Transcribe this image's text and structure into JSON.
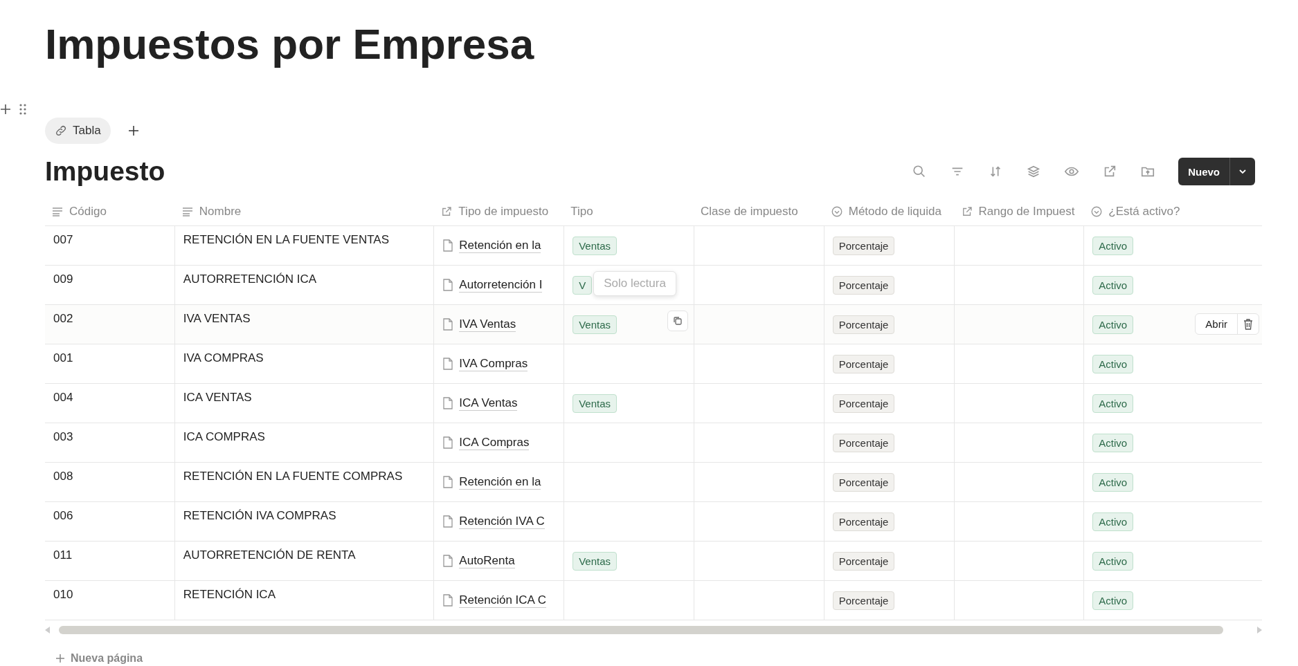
{
  "page_title": "Impuestos por Empresa",
  "views": [
    {
      "label": "Tabla",
      "selected": true
    }
  ],
  "database_title": "Impuesto",
  "new_button": {
    "label": "Nuevo"
  },
  "columns": [
    {
      "label": "Código",
      "kind": "text"
    },
    {
      "label": "Nombre",
      "kind": "text"
    },
    {
      "label": "Tipo de impuesto",
      "kind": "relation"
    },
    {
      "label": "Tipo",
      "kind": "plain"
    },
    {
      "label": "Clase de impuesto",
      "kind": "plain"
    },
    {
      "label": "Método de liquida",
      "kind": "status"
    },
    {
      "label": "Rango de Impuest",
      "kind": "relation"
    },
    {
      "label": "¿Está activo?",
      "kind": "status"
    }
  ],
  "row_actions": {
    "open": "Abrir"
  },
  "rows": [
    {
      "codigo": "007",
      "nombre": "RETENCIÓN EN LA FUENTE VENTAS",
      "tipo_impuesto": "Retención en la",
      "tipo": "Ventas",
      "metodo": "Porcentaje",
      "activo": "Activo",
      "hovered": false
    },
    {
      "codigo": "009",
      "nombre": "AUTORRETENCIÓN ICA",
      "tipo_impuesto": "Autorretención I",
      "tipo": "V",
      "tooltip": "Solo lectura",
      "metodo": "Porcentaje",
      "activo": "Activo",
      "hovered": false
    },
    {
      "codigo": "002",
      "nombre": "IVA VENTAS",
      "tipo_impuesto": "IVA Ventas",
      "tipo": "Ventas",
      "metodo": "Porcentaje",
      "activo": "Activo",
      "hovered": true
    },
    {
      "codigo": "001",
      "nombre": "IVA COMPRAS",
      "tipo_impuesto": "IVA Compras",
      "metodo": "Porcentaje",
      "activo": "Activo",
      "hovered": false
    },
    {
      "codigo": "004",
      "nombre": "ICA VENTAS",
      "tipo_impuesto": "ICA Ventas",
      "tipo": "Ventas",
      "metodo": "Porcentaje",
      "activo": "Activo",
      "hovered": false
    },
    {
      "codigo": "003",
      "nombre": "ICA COMPRAS",
      "tipo_impuesto": "ICA Compras",
      "metodo": "Porcentaje",
      "activo": "Activo",
      "hovered": false
    },
    {
      "codigo": "008",
      "nombre": "RETENCIÓN EN LA FUENTE COMPRAS",
      "tipo_impuesto": "Retención en la",
      "metodo": "Porcentaje",
      "activo": "Activo",
      "hovered": false
    },
    {
      "codigo": "006",
      "nombre": "RETENCIÓN IVA COMPRAS",
      "tipo_impuesto": "Retención IVA C",
      "metodo": "Porcentaje",
      "activo": "Activo",
      "hovered": false
    },
    {
      "codigo": "011",
      "nombre": "AUTORRETENCIÓN DE RENTA",
      "tipo_impuesto": "AutoRenta",
      "tipo": "Ventas",
      "metodo": "Porcentaje",
      "activo": "Activo",
      "hovered": false
    },
    {
      "codigo": "010",
      "nombre": "RETENCIÓN ICA",
      "tipo_impuesto": "Retención ICA C",
      "metodo": "Porcentaje",
      "activo": "Activo",
      "hovered": false
    }
  ],
  "new_page": "Nueva página"
}
